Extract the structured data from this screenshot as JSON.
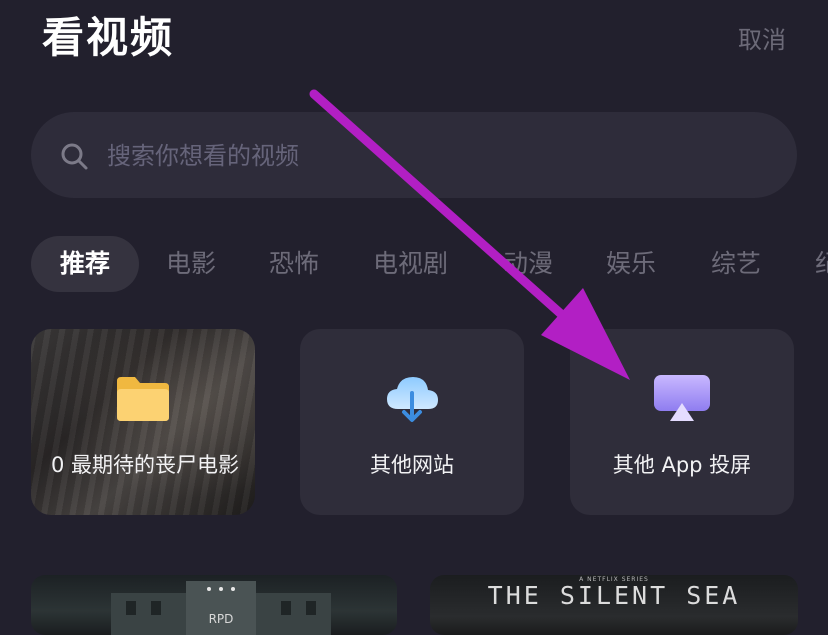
{
  "header": {
    "title": "看视频",
    "cancel": "取消"
  },
  "search": {
    "placeholder": "搜索你想看的视频",
    "value": ""
  },
  "tabs": [
    "推荐",
    "电影",
    "恐怖",
    "电视剧",
    "动漫",
    "娱乐",
    "综艺",
    "纪"
  ],
  "cards": [
    {
      "label": "0 最期待的丧尸电影",
      "icon": "folder-icon"
    },
    {
      "label": "其他网站",
      "icon": "cloud-download-icon"
    },
    {
      "label": "其他 App 投屏",
      "icon": "airplay-icon"
    }
  ],
  "thumbnails": [
    {
      "text": "RPD"
    },
    {
      "series": "A NETFLIX SERIES",
      "title": "THE SILENT SEA"
    }
  ],
  "colors": {
    "arrow": "#b21fc4",
    "background": "#22202d"
  }
}
